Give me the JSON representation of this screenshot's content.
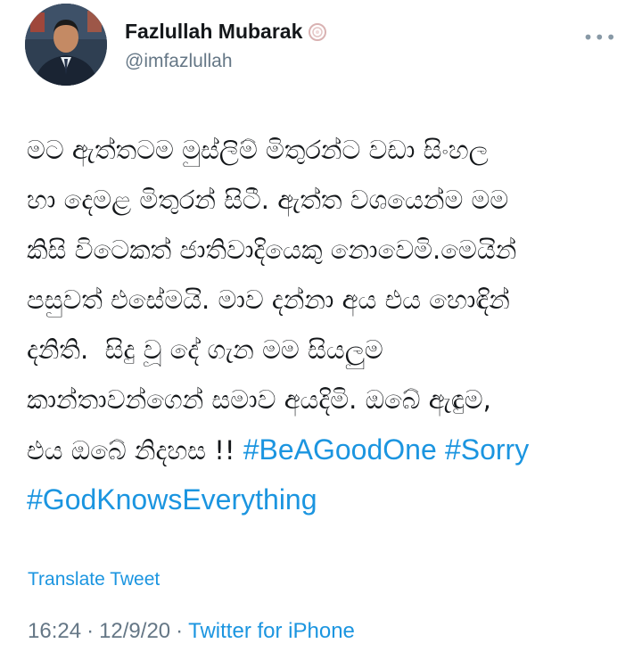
{
  "author": {
    "display_name": "Fazlullah Mubarak",
    "handle": "@imfazlullah"
  },
  "icons": {
    "more": "more-options-icon",
    "badge": "verified-badge-icon"
  },
  "tweet": {
    "lines": [
      [
        {
          "text": "මට ඇත්තටම මුස්ලිම් මිතුරන්ට වඩා සිංහල",
          "type": "text"
        }
      ],
      [
        {
          "text": "හා දෙමළ මිතුරන් සිටී. ඇත්ත වශයෙන්ම මම",
          "type": "text"
        }
      ],
      [
        {
          "text": "කිසි විටෙකත් ජාතිවාදියෙකු නොවෙමි.මෙයින්",
          "type": "text"
        }
      ],
      [
        {
          "text": "පසුවත් එසේමයි. මාව දන්නා අය එය හොඳින්",
          "type": "text"
        }
      ],
      [
        {
          "text": "දනිති.  සිදු වූ දේ ගැන මම සියලුම",
          "type": "text"
        }
      ],
      [
        {
          "text": "කාන්තාවන්ගෙන් සමාව අයදිමි. ඔබේ ඇඳුම,",
          "type": "text"
        }
      ],
      [
        {
          "text": "එය ඔබේ නිදහස !! ",
          "type": "text"
        },
        {
          "text": "#BeAGoodOne",
          "type": "hashtag"
        },
        {
          "text": " ",
          "type": "text"
        },
        {
          "text": "#Sorry",
          "type": "hashtag"
        }
      ],
      [
        {
          "text": "#GodKnowsEverything",
          "type": "hashtag"
        }
      ]
    ]
  },
  "translate_label": "Translate Tweet",
  "meta": {
    "time": "16:24",
    "sep1": "·",
    "date": "12/9/20",
    "sep2": "·",
    "source": "Twitter for iPhone"
  },
  "colors": {
    "link": "#1b95e0",
    "secondary": "#657786",
    "text": "#14171a"
  }
}
